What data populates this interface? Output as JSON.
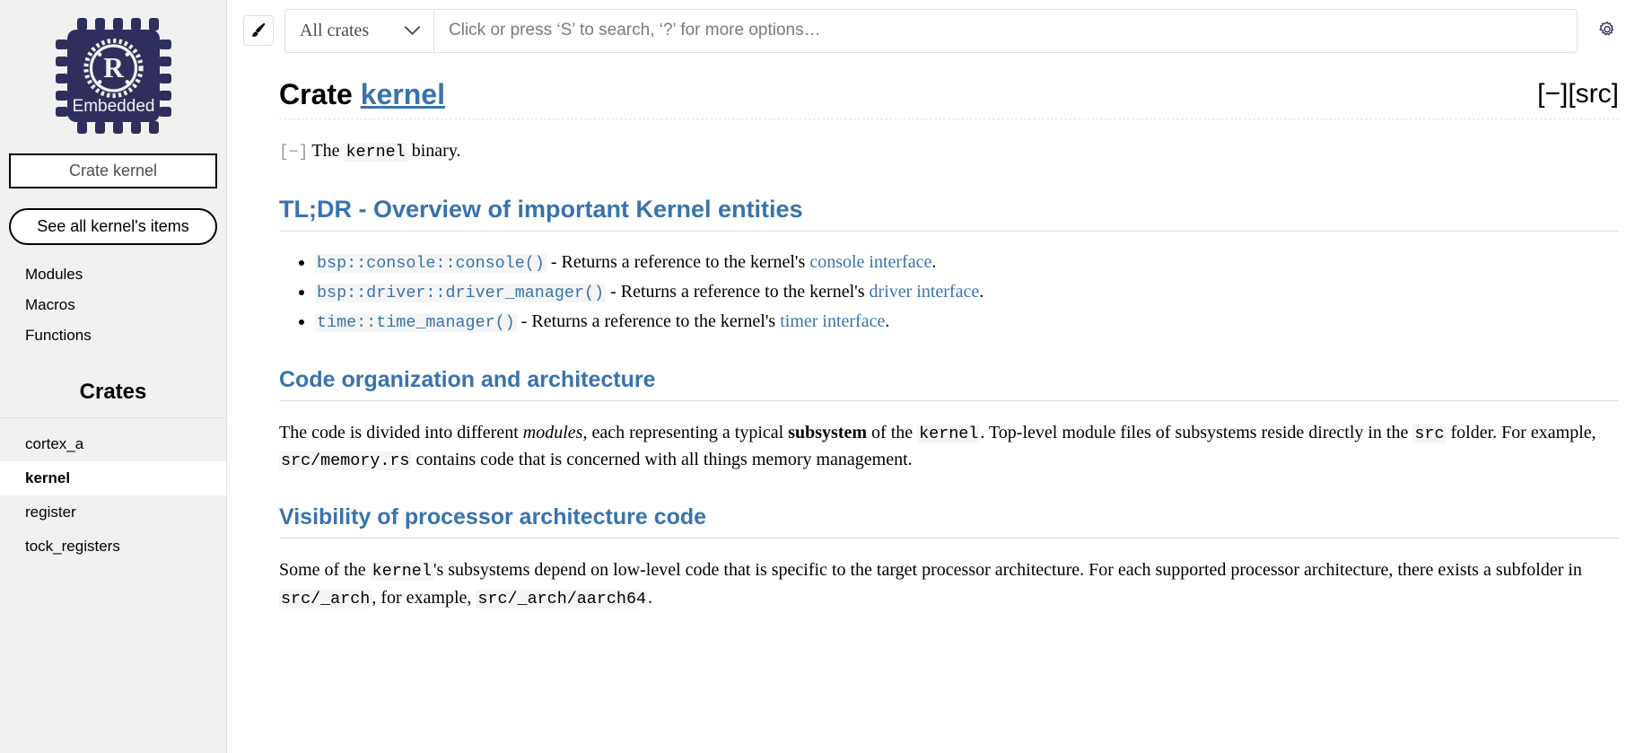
{
  "sidebar": {
    "logo": {
      "icon": "rust-embedded-logo",
      "label": "Embedded",
      "bg_color": "#2f2f5d"
    },
    "crate_title": "Crate kernel",
    "all_items_label": "See all kernel's items",
    "blocks": [
      {
        "label": "Modules",
        "name": "sidebar-item-modules"
      },
      {
        "label": "Macros",
        "name": "sidebar-item-macros"
      },
      {
        "label": "Functions",
        "name": "sidebar-item-functions"
      }
    ],
    "crates_heading": "Crates",
    "crates": [
      {
        "label": "cortex_a",
        "current": false
      },
      {
        "label": "kernel",
        "current": true
      },
      {
        "label": "register",
        "current": false
      },
      {
        "label": "tock_registers",
        "current": false
      }
    ]
  },
  "topbar": {
    "theme_icon": "paintbrush-icon",
    "crate_filter_selected": "All crates",
    "crate_filter_options": [
      "All crates",
      "cortex_a",
      "kernel",
      "register",
      "tock_registers"
    ],
    "chevron_icon": "chevron-down-icon",
    "search_placeholder": "Click or press ‘S’ to search, ‘?’ for more options…",
    "search_value": "",
    "settings_icon": "gear-icon"
  },
  "main": {
    "heading_prefix": "Crate",
    "heading_crate": "kernel",
    "out_of_band": {
      "collapse": "[−]",
      "src": "[src]"
    },
    "top_doc": {
      "toggle": "[−]",
      "text_before": "The ",
      "code": "kernel",
      "text_after": " binary."
    },
    "sections": [
      {
        "id": "tldr",
        "heading": "TL;DR - Overview of important Kernel entities",
        "items": [
          {
            "code": "bsp::console::console()",
            "text_mid": " - Returns a reference to the kernel's ",
            "link": "console interface",
            "text_end": "."
          },
          {
            "code": "bsp::driver::driver_manager()",
            "text_mid": " - Returns a reference to the kernel's ",
            "link": "driver interface",
            "text_end": "."
          },
          {
            "code": "time::time_manager()",
            "text_mid": " - Returns a reference to the kernel's ",
            "link": "timer interface",
            "text_end": "."
          }
        ]
      },
      {
        "id": "code-organization",
        "heading": "Code organization and architecture",
        "paragraph": {
          "p1": "The code is divided into different ",
          "em1": "modules,",
          "p2": " each representing a typical ",
          "strong1": "subsystem",
          "p3": " of the ",
          "code1": "kernel",
          "p4": ". Top-level module files of subsystems reside directly in the ",
          "code2": "src",
          "p5": " folder. For example, ",
          "code3": "src/memory.rs",
          "p6": " contains code that is concerned with all things memory management."
        }
      },
      {
        "id": "visibility",
        "heading": "Visibility of processor architecture code",
        "paragraph": {
          "p1": "Some of the ",
          "code1": "kernel",
          "p2": "'s subsystems depend on low-level code that is specific to the target processor architecture. For each supported processor architecture, there exists a subfolder in ",
          "code2": "src/_arch",
          "p3": ", for example, ",
          "code3": "src/_arch/aarch64",
          "p4": "."
        }
      }
    ]
  },
  "colors": {
    "link": "#3873ad",
    "sidebar_bg": "#f1f1f1",
    "code_bg": "#f5f5f5",
    "logo_bg": "#2f2f5d"
  }
}
